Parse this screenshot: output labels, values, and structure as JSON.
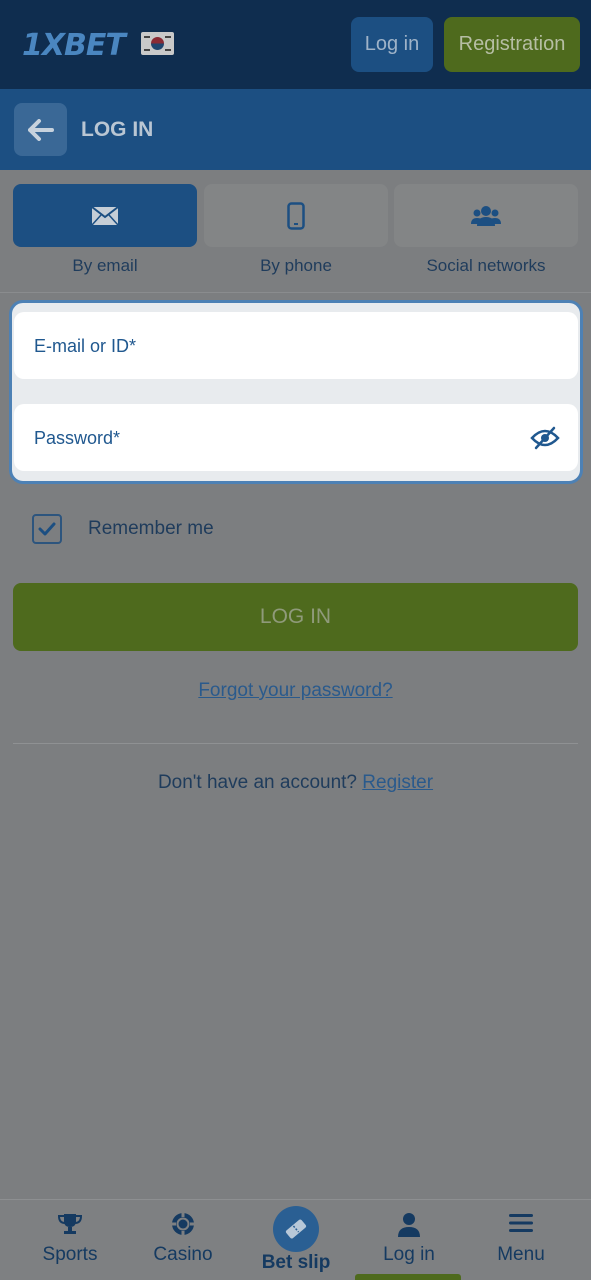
{
  "header": {
    "logo_text": "1XBET",
    "login_label": "Log in",
    "registration_label": "Registration"
  },
  "subheader": {
    "title": "LOG IN"
  },
  "tabs": [
    {
      "label": "By email",
      "icon": "envelope-icon",
      "active": true
    },
    {
      "label": "By phone",
      "icon": "phone-icon",
      "active": false
    },
    {
      "label": "Social networks",
      "icon": "users-icon",
      "active": false
    }
  ],
  "form": {
    "email_placeholder": "E-mail or ID*",
    "password_placeholder": "Password*",
    "remember_label": "Remember me",
    "remember_checked": true,
    "submit_label": "LOG IN",
    "forgot_label": "Forgot your password?",
    "no_account_text": "Don't have an account?",
    "register_link": "Register"
  },
  "bottom_nav": [
    {
      "label": "Sports",
      "icon": "trophy-icon"
    },
    {
      "label": "Casino",
      "icon": "casino-chip-icon"
    },
    {
      "label": "Bet slip",
      "icon": "ticket-icon"
    },
    {
      "label": "Log in",
      "icon": "user-icon",
      "active": true
    },
    {
      "label": "Menu",
      "icon": "hamburger-icon"
    }
  ],
  "colors": {
    "header_bg": "#0f2d4f",
    "primary": "#1c4f82",
    "accent_green": "#4e6a1d",
    "overlay": "#7c7e80"
  }
}
